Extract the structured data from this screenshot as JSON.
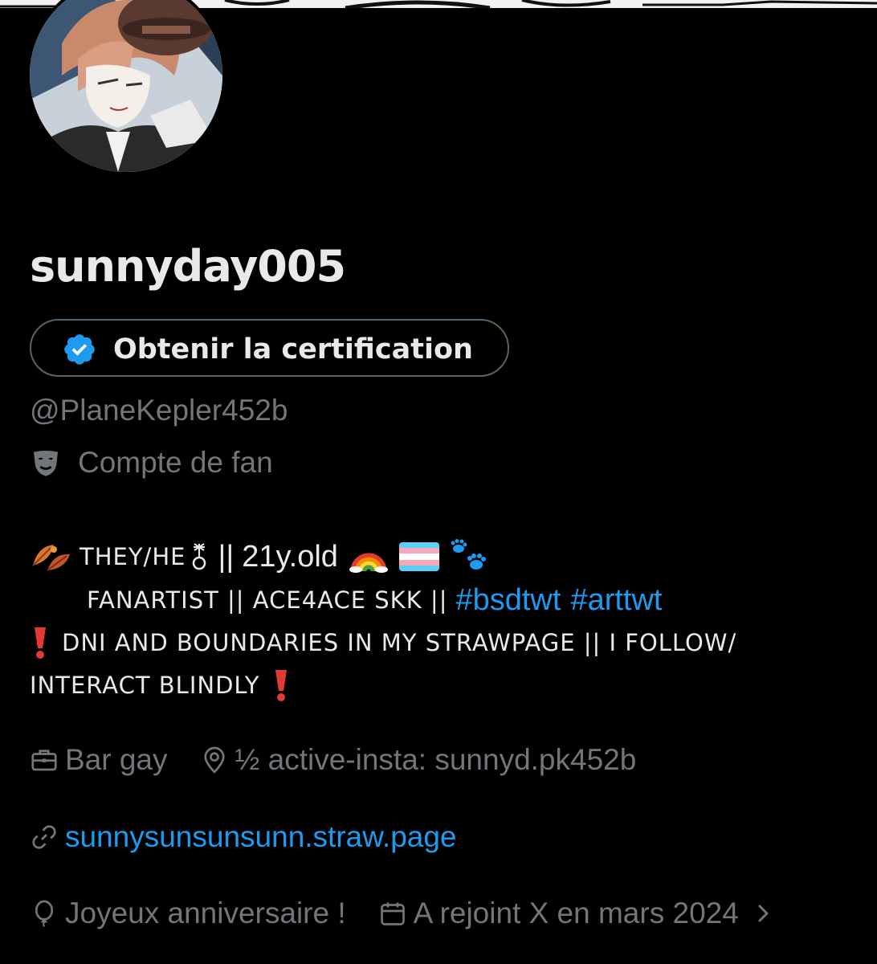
{
  "profile": {
    "display_name": "sunnyday005",
    "handle": "@PlaneKepler452b",
    "category": "Compte de fan",
    "verify_button_label": "Obtenir la certification"
  },
  "bio": {
    "line1_pronouns": "THEY/HE",
    "line1_sep": "||",
    "line1_age": "21y.old",
    "line2_text": "FANARTIST || ACE4ACE SKK ||",
    "line2_hashtag1": "#bsdtwt",
    "line2_hashtag2": "#arttwt",
    "line3_text": "DNI AND BOUNDARIES IN MY STRAWPAGE || I FOLLOW/",
    "line4_text": "INTERACT BLINDLY"
  },
  "meta": {
    "job": "Bar gay",
    "location": "½ active-insta: sunnyd.pk452b",
    "website": "sunnysunsunsunn.straw.page",
    "birthday": "Joyeux anniversaire !",
    "joined": "A rejoint X en mars 2024"
  },
  "colors": {
    "background": "#000000",
    "text_primary": "#e7e9ea",
    "text_secondary": "#71767b",
    "accent_blue": "#1d9bf0",
    "border": "#536471"
  },
  "icons": {
    "verify": "verified-badge-icon",
    "category": "theater-mask-icon",
    "job": "briefcase-icon",
    "location": "location-pin-icon",
    "website": "link-icon",
    "birthday": "balloon-icon",
    "joined": "calendar-icon",
    "joined_more": "chevron-right-icon"
  }
}
